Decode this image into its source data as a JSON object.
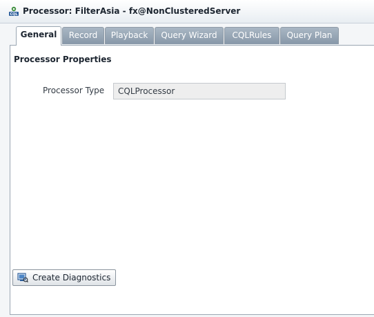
{
  "window": {
    "title": "Processor: FilterAsia - fx@NonClusteredServer",
    "icon": "cql-processor-icon"
  },
  "tabs": [
    {
      "label": "General",
      "active": true
    },
    {
      "label": "Record",
      "active": false
    },
    {
      "label": "Playback",
      "active": false
    },
    {
      "label": "Query Wizard",
      "active": false
    },
    {
      "label": "CQLRules",
      "active": false
    },
    {
      "label": "Query Plan",
      "active": false
    }
  ],
  "general": {
    "section_title": "Processor Properties",
    "processor_type_label": "Processor Type",
    "processor_type_value": "CQLProcessor"
  },
  "actions": {
    "create_diagnostics_label": "Create Diagnostics",
    "create_diagnostics_icon": "diagnostics-icon"
  },
  "colors": {
    "tab_inactive": "#8797a8",
    "panel_border": "#9aa6b2"
  }
}
